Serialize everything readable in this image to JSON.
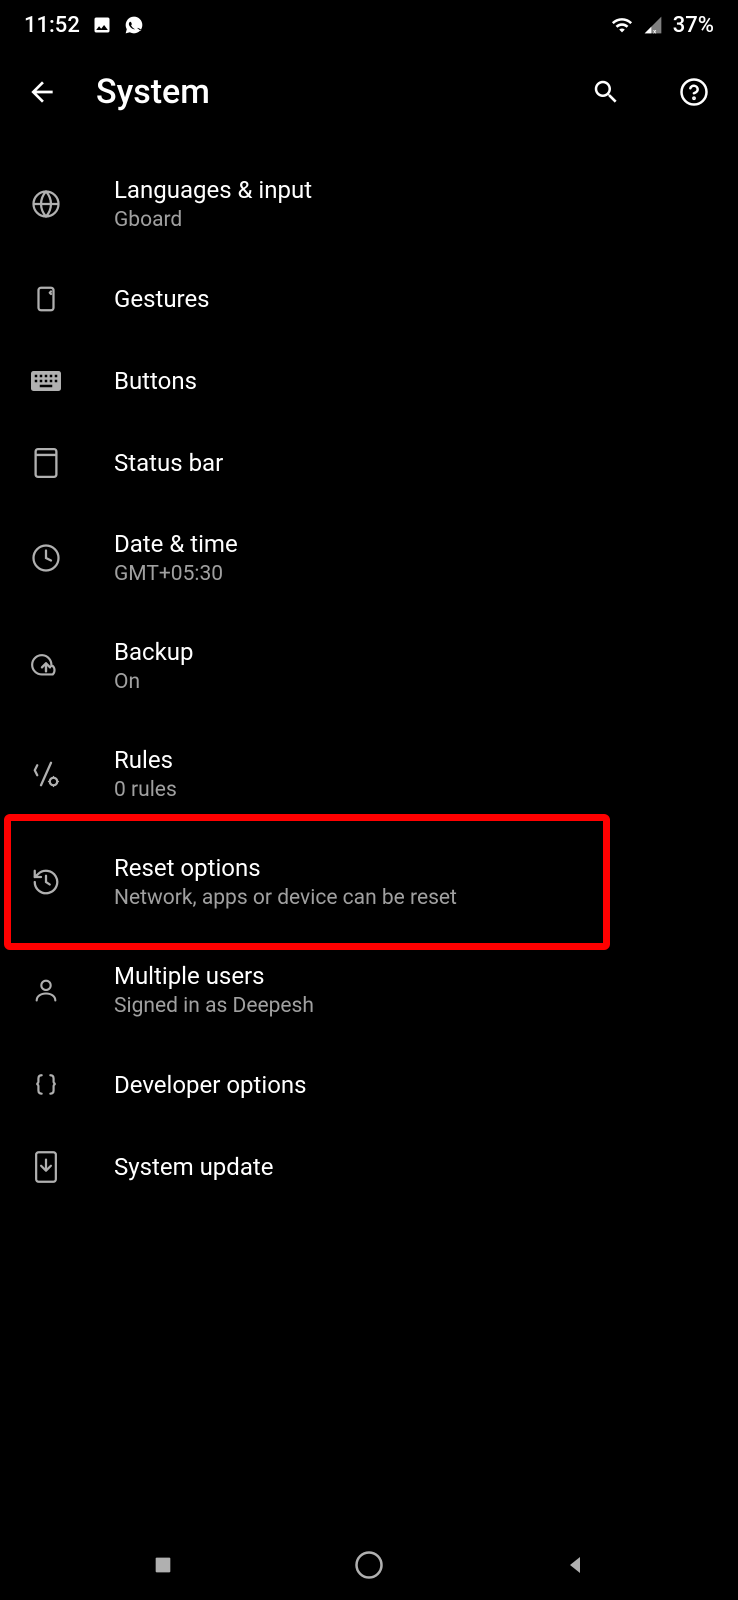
{
  "statusBar": {
    "time": "11:52",
    "battery": "37%"
  },
  "header": {
    "title": "System"
  },
  "items": [
    {
      "icon": "globe",
      "title": "Languages & input",
      "subtitle": "Gboard"
    },
    {
      "icon": "phone-sparkle",
      "title": "Gestures",
      "subtitle": null
    },
    {
      "icon": "keyboard",
      "title": "Buttons",
      "subtitle": null
    },
    {
      "icon": "rectangle",
      "title": "Status bar",
      "subtitle": null
    },
    {
      "icon": "clock",
      "title": "Date & time",
      "subtitle": "GMT+05:30"
    },
    {
      "icon": "cloud-upload",
      "title": "Backup",
      "subtitle": "On"
    },
    {
      "icon": "rules",
      "title": "Rules",
      "subtitle": "0 rules"
    },
    {
      "icon": "reset",
      "title": "Reset options",
      "subtitle": "Network, apps or device can be reset",
      "highlighted": true
    },
    {
      "icon": "user",
      "title": "Multiple users",
      "subtitle": "Signed in as Deepesh"
    },
    {
      "icon": "braces",
      "title": "Developer options",
      "subtitle": null
    },
    {
      "icon": "phone-download",
      "title": "System update",
      "subtitle": null
    }
  ]
}
